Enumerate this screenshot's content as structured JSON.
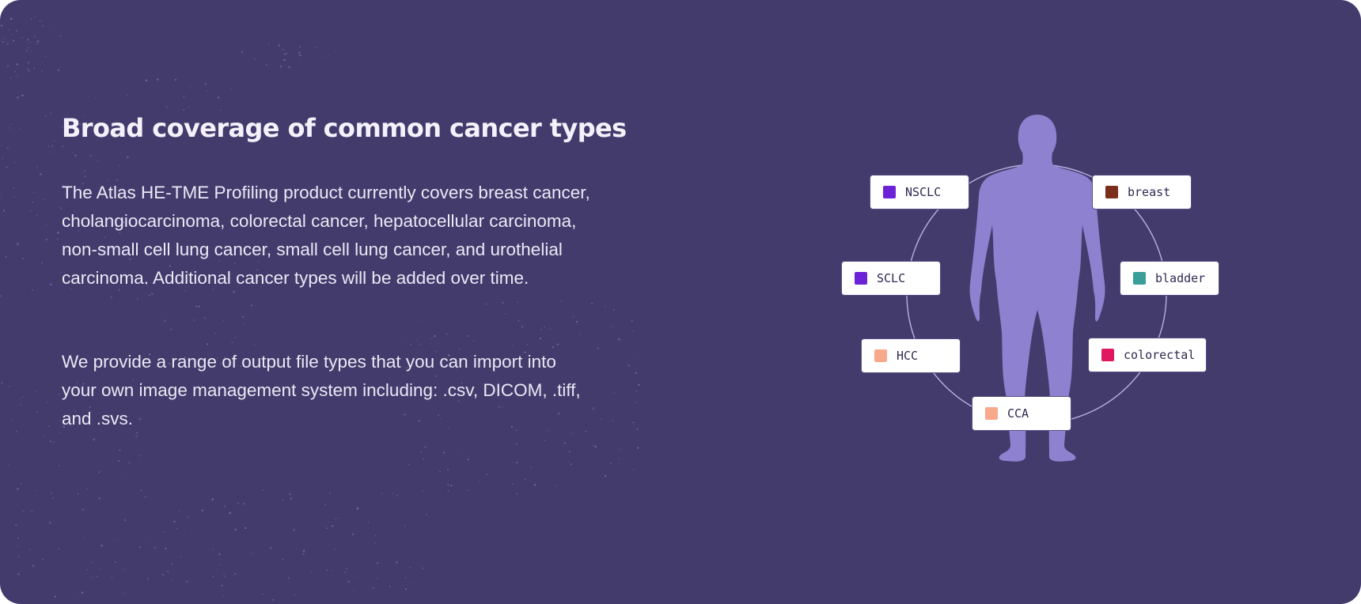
{
  "colors": {
    "background": "#433b6b",
    "heading": "#f4f1fb",
    "body_text": "#ebe8f6",
    "silhouette": "#8d81d0",
    "ring": "#b9b1e0",
    "chip_background": "#ffffff",
    "chip_text": "#2d2a52",
    "speckle": "#7d72ad"
  },
  "heading": "Broad coverage of common cancer types",
  "paragraphs": [
    "The Atlas HE-TME Profiling product currently covers breast cancer, cholangiocarcinoma, colorectal cancer, hepatocellular carcinoma, non-small cell lung cancer, small cell lung cancer, and urothelial carcinoma. Additional cancer types will be added over time.",
    "We provide a range of output file types that you can import into your own image management system including: .csv, DICOM, .tiff, and .svs."
  ],
  "figure": {
    "icon": "human-body-silhouette",
    "cancer_types": [
      {
        "label": "NSCLC",
        "color": "#6c22d6"
      },
      {
        "label": "breast",
        "color": "#7b2e1c"
      },
      {
        "label": "SCLC",
        "color": "#6c22d6"
      },
      {
        "label": "bladder",
        "color": "#3a9e9a"
      },
      {
        "label": "HCC",
        "color": "#f9a98b"
      },
      {
        "label": "colorectal",
        "color": "#e0185f"
      },
      {
        "label": "CCA",
        "color": "#f9a98b"
      }
    ]
  }
}
